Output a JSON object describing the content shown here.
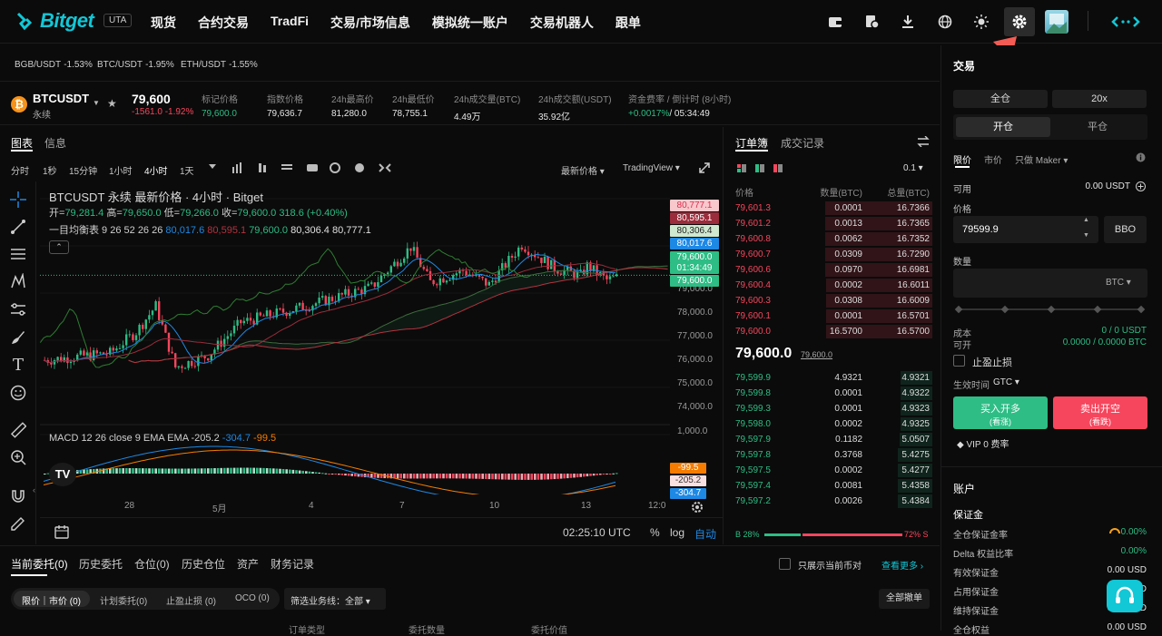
{
  "nav": {
    "logo": "Bitget",
    "uta": "UTA",
    "items": [
      "现货",
      "合约交易",
      "TradFi",
      "交易/市场信息",
      "模拟统一账户",
      "交易机器人",
      "跟单"
    ]
  },
  "tickers": [
    {
      "pair": "BGB/USDT",
      "chg": "-1.53%"
    },
    {
      "pair": "BTC/USDT",
      "chg": "-1.95%"
    },
    {
      "pair": "ETH/USDT",
      "chg": "-1.55%"
    }
  ],
  "symbol": {
    "name": "BTCUSDT",
    "sub": "永续",
    "price": "79,600",
    "change": "-1561.0",
    "change_pct": "-1.92%"
  },
  "stats": [
    {
      "label": "标记价格",
      "value": "79,600.0",
      "green": true
    },
    {
      "label": "指数价格",
      "value": "79,636.7"
    },
    {
      "label": "24h最高价",
      "value": "81,280.0"
    },
    {
      "label": "24h最低价",
      "value": "78,755.1"
    },
    {
      "label": "24h成交量(BTC)",
      "value": "4.49万"
    },
    {
      "label": "24h成交额(USDT)",
      "value": "35.92亿"
    },
    {
      "label": "资金费率 / 倒计时 (8小时)",
      "value": "+0.0017%",
      "value2": "/ 05:34:49"
    }
  ],
  "chart_tabs": [
    "图表",
    "信息"
  ],
  "timeframes": [
    "分时",
    "1秒",
    "15分钟",
    "1小时",
    "4小时",
    "1天"
  ],
  "chart_opts": {
    "price_type": "最新价格",
    "view": "TradingView"
  },
  "legend": {
    "title": "BTCUSDT 永续 最新价格 · 4小时 · Bitget",
    "ohlc_open_lbl": "开=",
    "open": "79,281.4",
    "high_lbl": "高=",
    "high": "79,650.0",
    "low_lbl": "低=",
    "low": "79,266.0",
    "close_lbl": "收=",
    "close": "79,600.0",
    "chg": "318.6 (+0.40%)",
    "ichimoku": "一目均衡表 9 26 52 26 26",
    "i1": "80,017.6",
    "i2": "80,595.1",
    "i3": "79,600.0",
    "i4": "80,306.4",
    "i5": "80,777.1",
    "macd": "MACD 12 26 close 9 EMA EMA",
    "m1": "-205.2",
    "m2": "-304.7",
    "m3": "-99.5"
  },
  "yaxis": [
    "79,000.0",
    "78,000.0",
    "77,000.0",
    "76,000.0",
    "75,000.0",
    "74,000.0"
  ],
  "ytags": [
    {
      "v": "80,777.1",
      "bg": "#f8c8cc",
      "fg": "#d9304f"
    },
    {
      "v": "80,595.1",
      "bg": "#9b2c3b",
      "fg": "#ffffff"
    },
    {
      "v": "80,306.4",
      "bg": "#cfe8d0",
      "fg": "#222"
    },
    {
      "v": "80,017.6",
      "bg": "#1e88e5",
      "fg": "#ffffff"
    },
    {
      "v": "79,600.0",
      "bg": "#2ebd85",
      "fg": "#ffffff"
    },
    {
      "v": "01:34:49",
      "bg": "#2ebd85",
      "fg": "#ffffff"
    },
    {
      "v": "79,600.0",
      "bg": "#2ebd85",
      "fg": "#ffffff"
    }
  ],
  "macd_axis": "1,000.0",
  "macd_tags": [
    {
      "v": "-99.5",
      "bg": "#f57c00",
      "fg": "#fff"
    },
    {
      "v": "-205.2",
      "bg": "#fbe0e2",
      "fg": "#333"
    },
    {
      "v": "-304.7",
      "bg": "#1e88e5",
      "fg": "#fff"
    }
  ],
  "xaxis": [
    "28",
    "5月",
    "4",
    "7",
    "10",
    "13",
    "12:0"
  ],
  "chart_footer": {
    "time": "02:25:10 UTC",
    "pct": "%",
    "log": "log",
    "auto": "自动"
  },
  "orderbook": {
    "tabs": [
      "订单簿",
      "成交记录"
    ],
    "precision": "0.1",
    "headers": [
      "价格",
      "数量(BTC)",
      "总量(BTC)"
    ],
    "asks": [
      [
        "79,601.3",
        "0.0001",
        "16.7366"
      ],
      [
        "79,601.2",
        "0.0013",
        "16.7365"
      ],
      [
        "79,600.8",
        "0.0062",
        "16.7352"
      ],
      [
        "79,600.7",
        "0.0309",
        "16.7290"
      ],
      [
        "79,600.6",
        "0.0970",
        "16.6981"
      ],
      [
        "79,600.4",
        "0.0002",
        "16.6011"
      ],
      [
        "79,600.3",
        "0.0308",
        "16.6009"
      ],
      [
        "79,600.1",
        "0.0001",
        "16.5701"
      ],
      [
        "79,600.0",
        "16.5700",
        "16.5700"
      ]
    ],
    "last": "79,600.0",
    "mark": "79,600.0",
    "bids": [
      [
        "79,599.9",
        "4.9321",
        "4.9321"
      ],
      [
        "79,599.8",
        "0.0001",
        "4.9322"
      ],
      [
        "79,599.3",
        "0.0001",
        "4.9323"
      ],
      [
        "79,598.0",
        "0.0002",
        "4.9325"
      ],
      [
        "79,597.9",
        "0.1182",
        "5.0507"
      ],
      [
        "79,597.8",
        "0.3768",
        "5.4275"
      ],
      [
        "79,597.5",
        "0.0002",
        "5.4277"
      ],
      [
        "79,597.4",
        "0.0081",
        "5.4358"
      ],
      [
        "79,597.2",
        "0.0026",
        "5.4384"
      ]
    ],
    "ratio_b": "B 28%",
    "ratio_s": "72% S"
  },
  "trade": {
    "title": "交易",
    "cross": "全仓",
    "lev": "20x",
    "open": "开仓",
    "close": "平仓",
    "types": [
      "限价",
      "市价",
      "只做 Maker"
    ],
    "avail_lbl": "可用",
    "avail": "0.00 USDT",
    "price_lbl": "价格",
    "price": "79599.9",
    "bbo": "BBO",
    "qty_lbl": "数量",
    "unit": "BTC",
    "cost_lbl": "成本",
    "cost": "0 / 0 USDT",
    "open_lbl": "可开",
    "open_v": "0.0000 / 0.0000 BTC",
    "tpsl": "止盈止损",
    "tif_lbl": "生效时间",
    "tif": "GTC",
    "buy": "买入开多",
    "buy_sub": "(看涨)",
    "sell": "卖出开空",
    "sell_sub": "(看跌)",
    "vip": "VIP 0 费率"
  },
  "account": {
    "title": "账户",
    "margin": "保证金",
    "rows": [
      [
        "全仓保证金率",
        "0.00%"
      ],
      [
        "Delta 权益比率",
        "0.00%"
      ],
      [
        "有效保证金",
        "0.00 USD"
      ],
      [
        "占用保证金",
        "0.00 USD"
      ],
      [
        "维持保证金",
        "0.00 USD"
      ],
      [
        "全仓权益",
        "0.00 USD"
      ]
    ]
  },
  "bottom": {
    "tabs": [
      "当前委托(0)",
      "历史委托",
      "仓位(0)",
      "历史仓位",
      "资产",
      "财务记录"
    ],
    "only_current": "只展示当前币对",
    "more": "查看更多",
    "subtabs": [
      "限价｜市价 (0)",
      "计划委托(0)",
      "止盈止损 (0)",
      "OCO (0)"
    ],
    "filter": "筛选业务线：全部",
    "cancel_all": "全部撤单",
    "cols": [
      "订单类型",
      "委托数量",
      "委托价值"
    ]
  }
}
